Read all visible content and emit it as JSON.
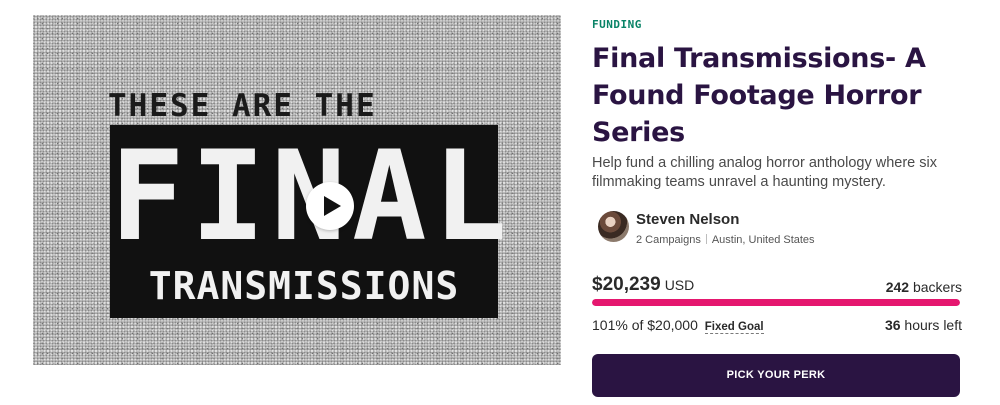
{
  "video": {
    "pre_title": "THESE ARE THE",
    "title_main": "FINAL",
    "title_sub": "TRANSMISSIONS",
    "play_icon": "play-icon"
  },
  "campaign": {
    "badge": "FUNDING",
    "title": "Final Transmissions- A Found Footage Horror Series",
    "blurb": "Help fund a chilling analog horror anthology where six filmmaking teams unravel a haunting mystery."
  },
  "owner": {
    "name": "Steven Nelson",
    "campaigns": "2 Campaigns",
    "location": "Austin, United States"
  },
  "funding": {
    "amount": "$20,239",
    "currency": "USD",
    "backers_count": "242",
    "backers_label": "backers",
    "percent_text": "101% of $20,000",
    "goal_type": "Fixed Goal",
    "hours_count": "36",
    "hours_label": "hours left",
    "progress_fraction": 1.0
  },
  "cta": {
    "label": "PICK YOUR PERK"
  },
  "colors": {
    "title": "#2a1442",
    "badge": "#088366",
    "progress": "#e5176f",
    "button": "#2a1442"
  }
}
